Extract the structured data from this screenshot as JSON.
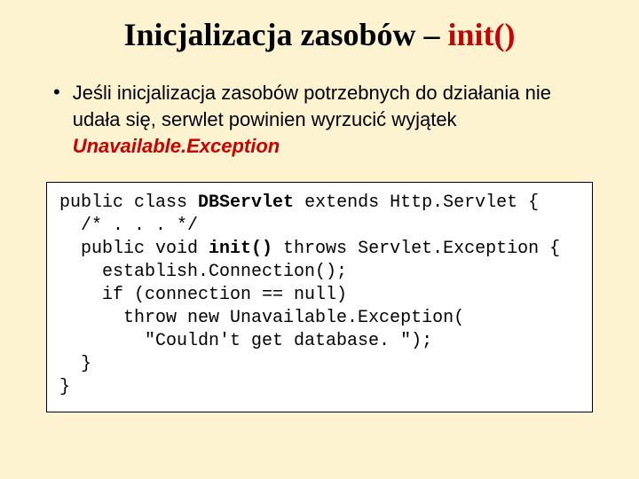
{
  "title": {
    "prefix": "Inicjalizacja zasobów – ",
    "accent": "init()"
  },
  "bullet": {
    "dot": "•",
    "text_before": "Jeśli inicjalizacja zasobów potrzebnych do działania nie udała się, serwlet powinien wyrzucić wyjątek ",
    "emph": "Unavailable.Exception"
  },
  "code": {
    "l1a": "public class ",
    "l1b": "DBServlet",
    "l1c": " extends Http.Servlet {",
    "l2": "  /* . . . */",
    "l3a": "  public void ",
    "l3b": "init()",
    "l3c": " throws Servlet.Exception {",
    "l4": "    establish.Connection();",
    "l5": "    if (connection == null)",
    "l6": "      throw new Unavailable.Exception(",
    "l7": "        \"Couldn't get database. \");",
    "l8": "  }",
    "l9": "}"
  }
}
